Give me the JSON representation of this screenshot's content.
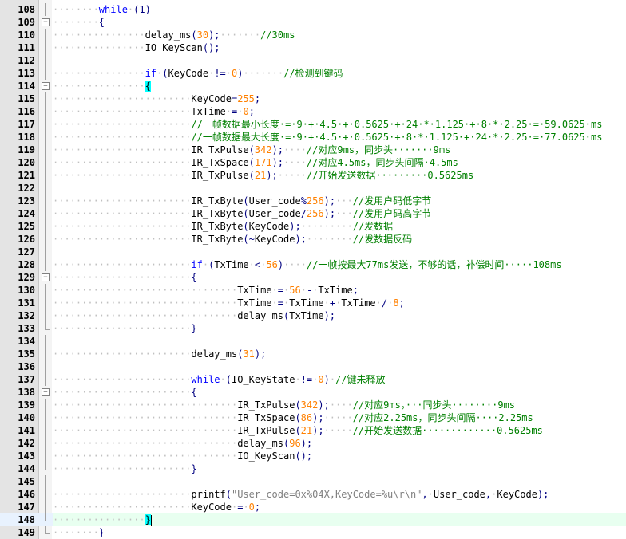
{
  "editor": {
    "lines": [
      {
        "n": "108",
        "indent": 2,
        "tokens": [
          [
            "kw",
            "while"
          ],
          [
            "ws",
            "·"
          ],
          [
            "op",
            "(1)"
          ]
        ]
      },
      {
        "n": "109",
        "indent": 2,
        "fold": "open",
        "tokens": [
          [
            "op",
            "{"
          ]
        ]
      },
      {
        "n": "110",
        "indent": 4,
        "tokens": [
          [
            "t",
            "delay_ms"
          ],
          [
            "op",
            "("
          ],
          [
            "num",
            "30"
          ],
          [
            "op",
            ");"
          ],
          [
            "ws",
            "·······"
          ],
          [
            "cmt",
            "//30ms"
          ]
        ]
      },
      {
        "n": "111",
        "indent": 4,
        "tokens": [
          [
            "t",
            "IO_KeyScan"
          ],
          [
            "op",
            "();"
          ]
        ]
      },
      {
        "n": "112",
        "indent": 0,
        "tokens": []
      },
      {
        "n": "113",
        "indent": 4,
        "tokens": [
          [
            "kw",
            "if"
          ],
          [
            "ws",
            "·"
          ],
          [
            "op",
            "("
          ],
          [
            "t",
            "KeyCode"
          ],
          [
            "ws",
            "·"
          ],
          [
            "op",
            "!="
          ],
          [
            "ws",
            "·"
          ],
          [
            "num",
            "0"
          ],
          [
            "op",
            ")"
          ],
          [
            "ws",
            "·······"
          ],
          [
            "cmt",
            "//检测到键码"
          ]
        ]
      },
      {
        "n": "114",
        "indent": 4,
        "fold": "open",
        "tokens": [
          [
            "br",
            "{"
          ]
        ]
      },
      {
        "n": "115",
        "indent": 6,
        "tokens": [
          [
            "t",
            "KeyCode"
          ],
          [
            "op",
            "="
          ],
          [
            "num",
            "255"
          ],
          [
            "op",
            ";"
          ]
        ]
      },
      {
        "n": "116",
        "indent": 6,
        "tokens": [
          [
            "t",
            "TxTime"
          ],
          [
            "ws",
            "·"
          ],
          [
            "op",
            "="
          ],
          [
            "ws",
            "·"
          ],
          [
            "num",
            "0"
          ],
          [
            "op",
            ";"
          ]
        ]
      },
      {
        "n": "117",
        "indent": 6,
        "tokens": [
          [
            "cmt",
            "//一帧数据最小长度·=·9·+·4.5·+·0.5625·+·24·*·1.125·+·8·*·2.25·=·59.0625·ms"
          ]
        ]
      },
      {
        "n": "118",
        "indent": 6,
        "tokens": [
          [
            "cmt",
            "//一帧数据最大长度·=·9·+·4.5·+·0.5625·+·8·*·1.125·+·24·*·2.25·=·77.0625·ms"
          ]
        ]
      },
      {
        "n": "119",
        "indent": 6,
        "tokens": [
          [
            "t",
            "IR_TxPulse"
          ],
          [
            "op",
            "("
          ],
          [
            "num",
            "342"
          ],
          [
            "op",
            ");"
          ],
          [
            "ws",
            "····"
          ],
          [
            "cmt",
            "//对应9ms，同步头·······9ms"
          ]
        ]
      },
      {
        "n": "120",
        "indent": 6,
        "tokens": [
          [
            "t",
            "IR_TxSpace"
          ],
          [
            "op",
            "("
          ],
          [
            "num",
            "171"
          ],
          [
            "op",
            ");"
          ],
          [
            "ws",
            "····"
          ],
          [
            "cmt",
            "//对应4.5ms，同步头间隔·4.5ms"
          ]
        ]
      },
      {
        "n": "121",
        "indent": 6,
        "tokens": [
          [
            "t",
            "IR_TxPulse"
          ],
          [
            "op",
            "("
          ],
          [
            "num",
            "21"
          ],
          [
            "op",
            ");"
          ],
          [
            "ws",
            "·····"
          ],
          [
            "cmt",
            "//开始发送数据·········0.5625ms"
          ]
        ]
      },
      {
        "n": "122",
        "indent": 0,
        "tokens": []
      },
      {
        "n": "123",
        "indent": 6,
        "tokens": [
          [
            "t",
            "IR_TxByte"
          ],
          [
            "op",
            "("
          ],
          [
            "t",
            "User_code"
          ],
          [
            "op",
            "%"
          ],
          [
            "num",
            "256"
          ],
          [
            "op",
            ");"
          ],
          [
            "ws",
            "···"
          ],
          [
            "cmt",
            "//发用户码低字节"
          ]
        ]
      },
      {
        "n": "124",
        "indent": 6,
        "tokens": [
          [
            "t",
            "IR_TxByte"
          ],
          [
            "op",
            "("
          ],
          [
            "t",
            "User_code"
          ],
          [
            "op",
            "/"
          ],
          [
            "num",
            "256"
          ],
          [
            "op",
            ");"
          ],
          [
            "ws",
            "···"
          ],
          [
            "cmt",
            "//发用户码高字节"
          ]
        ]
      },
      {
        "n": "125",
        "indent": 6,
        "tokens": [
          [
            "t",
            "IR_TxByte"
          ],
          [
            "op",
            "("
          ],
          [
            "t",
            "KeyCode"
          ],
          [
            "op",
            ");"
          ],
          [
            "ws",
            "·········"
          ],
          [
            "cmt",
            "//发数据"
          ]
        ]
      },
      {
        "n": "126",
        "indent": 6,
        "tokens": [
          [
            "t",
            "IR_TxByte"
          ],
          [
            "op",
            "(~"
          ],
          [
            "t",
            "KeyCode"
          ],
          [
            "op",
            ");"
          ],
          [
            "ws",
            "········"
          ],
          [
            "cmt",
            "//发数据反码"
          ]
        ]
      },
      {
        "n": "127",
        "indent": 0,
        "tokens": []
      },
      {
        "n": "128",
        "indent": 6,
        "tokens": [
          [
            "kw",
            "if"
          ],
          [
            "ws",
            "·"
          ],
          [
            "op",
            "("
          ],
          [
            "t",
            "TxTime"
          ],
          [
            "ws",
            "·"
          ],
          [
            "op",
            "<"
          ],
          [
            "ws",
            "·"
          ],
          [
            "num",
            "56"
          ],
          [
            "op",
            ")"
          ],
          [
            "ws",
            "····"
          ],
          [
            "cmt",
            "//一帧按最大77ms发送，不够的话，补偿时间·····108ms"
          ]
        ]
      },
      {
        "n": "129",
        "indent": 6,
        "fold": "open",
        "tokens": [
          [
            "op",
            "{"
          ]
        ]
      },
      {
        "n": "130",
        "indent": 8,
        "tokens": [
          [
            "t",
            "TxTime"
          ],
          [
            "ws",
            "·"
          ],
          [
            "op",
            "="
          ],
          [
            "ws",
            "·"
          ],
          [
            "num",
            "56"
          ],
          [
            "ws",
            "·"
          ],
          [
            "op",
            "-"
          ],
          [
            "ws",
            "·"
          ],
          [
            "t",
            "TxTime"
          ],
          [
            "op",
            ";"
          ]
        ]
      },
      {
        "n": "131",
        "indent": 8,
        "tokens": [
          [
            "t",
            "TxTime"
          ],
          [
            "ws",
            "·"
          ],
          [
            "op",
            "="
          ],
          [
            "ws",
            "·"
          ],
          [
            "t",
            "TxTime"
          ],
          [
            "ws",
            "·"
          ],
          [
            "op",
            "+"
          ],
          [
            "ws",
            "·"
          ],
          [
            "t",
            "TxTime"
          ],
          [
            "ws",
            "·"
          ],
          [
            "op",
            "/"
          ],
          [
            "ws",
            "·"
          ],
          [
            "num",
            "8"
          ],
          [
            "op",
            ";"
          ]
        ]
      },
      {
        "n": "132",
        "indent": 8,
        "tokens": [
          [
            "t",
            "delay_ms"
          ],
          [
            "op",
            "("
          ],
          [
            "t",
            "TxTime"
          ],
          [
            "op",
            ");"
          ]
        ]
      },
      {
        "n": "133",
        "indent": 6,
        "foldend": true,
        "tokens": [
          [
            "op",
            "}"
          ]
        ]
      },
      {
        "n": "134",
        "indent": 0,
        "tokens": []
      },
      {
        "n": "135",
        "indent": 6,
        "tokens": [
          [
            "t",
            "delay_ms"
          ],
          [
            "op",
            "("
          ],
          [
            "num",
            "31"
          ],
          [
            "op",
            ");"
          ]
        ]
      },
      {
        "n": "136",
        "indent": 0,
        "tokens": []
      },
      {
        "n": "137",
        "indent": 6,
        "tokens": [
          [
            "kw",
            "while"
          ],
          [
            "ws",
            "·"
          ],
          [
            "op",
            "("
          ],
          [
            "t",
            "IO_KeyState"
          ],
          [
            "ws",
            "·"
          ],
          [
            "op",
            "!="
          ],
          [
            "ws",
            "·"
          ],
          [
            "num",
            "0"
          ],
          [
            "op",
            ")"
          ],
          [
            "ws",
            "·"
          ],
          [
            "cmt",
            "//键未释放"
          ]
        ]
      },
      {
        "n": "138",
        "indent": 6,
        "fold": "open",
        "tokens": [
          [
            "op",
            "{"
          ]
        ]
      },
      {
        "n": "139",
        "indent": 8,
        "tokens": [
          [
            "t",
            "IR_TxPulse"
          ],
          [
            "op",
            "("
          ],
          [
            "num",
            "342"
          ],
          [
            "op",
            ");"
          ],
          [
            "ws",
            "····"
          ],
          [
            "cmt",
            "//对应9ms，···同步头········9ms"
          ]
        ]
      },
      {
        "n": "140",
        "indent": 8,
        "tokens": [
          [
            "t",
            "IR_TxSpace"
          ],
          [
            "op",
            "("
          ],
          [
            "num",
            "86"
          ],
          [
            "op",
            ");"
          ],
          [
            "ws",
            "·····"
          ],
          [
            "cmt",
            "//对应2.25ms，同步头间隔····2.25ms"
          ]
        ]
      },
      {
        "n": "141",
        "indent": 8,
        "tokens": [
          [
            "t",
            "IR_TxPulse"
          ],
          [
            "op",
            "("
          ],
          [
            "num",
            "21"
          ],
          [
            "op",
            ");"
          ],
          [
            "ws",
            "·····"
          ],
          [
            "cmt",
            "//开始发送数据·············0.5625ms"
          ]
        ]
      },
      {
        "n": "142",
        "indent": 8,
        "tokens": [
          [
            "t",
            "delay_ms"
          ],
          [
            "op",
            "("
          ],
          [
            "num",
            "96"
          ],
          [
            "op",
            ");"
          ]
        ]
      },
      {
        "n": "143",
        "indent": 8,
        "tokens": [
          [
            "t",
            "IO_KeyScan"
          ],
          [
            "op",
            "();"
          ]
        ]
      },
      {
        "n": "144",
        "indent": 6,
        "foldend": true,
        "tokens": [
          [
            "op",
            "}"
          ]
        ]
      },
      {
        "n": "145",
        "indent": 0,
        "tokens": []
      },
      {
        "n": "146",
        "indent": 6,
        "tokens": [
          [
            "t",
            "printf"
          ],
          [
            "op",
            "("
          ],
          [
            "str",
            "\"User_code=0x%04X,KeyCode=%u\\r\\n\""
          ],
          [
            "op",
            ","
          ],
          [
            "ws",
            "·"
          ],
          [
            "t",
            "User_code"
          ],
          [
            "op",
            ","
          ],
          [
            "ws",
            "·"
          ],
          [
            "t",
            "KeyCode"
          ],
          [
            "op",
            ");"
          ]
        ]
      },
      {
        "n": "147",
        "indent": 6,
        "tokens": [
          [
            "t",
            "KeyCode"
          ],
          [
            "ws",
            "·"
          ],
          [
            "op",
            "="
          ],
          [
            "ws",
            "·"
          ],
          [
            "num",
            "0"
          ],
          [
            "op",
            ";"
          ]
        ]
      },
      {
        "n": "148",
        "indent": 4,
        "active": true,
        "foldend": true,
        "tokens": [
          [
            "br",
            "}"
          ],
          [
            "caret",
            ""
          ]
        ]
      },
      {
        "n": "149",
        "indent": 2,
        "foldend": true,
        "tokens": [
          [
            "op",
            "}"
          ]
        ]
      }
    ]
  }
}
